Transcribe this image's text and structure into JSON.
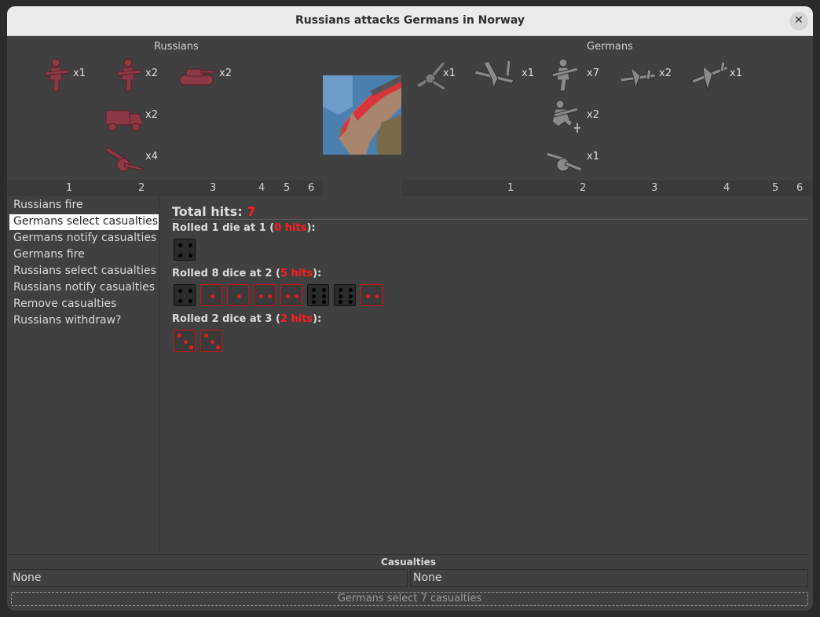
{
  "window": {
    "title": "Russians attacks Germans in Norway"
  },
  "attacker": {
    "name": "Russians",
    "units": [
      {
        "icon": "infantry-icon",
        "count": "x1"
      },
      {
        "icon": "infantry-icon",
        "count": "x2"
      },
      {
        "icon": "tank-icon",
        "count": "x2"
      },
      {
        "icon": "truck-icon",
        "count": "x2"
      },
      {
        "icon": "artillery-icon",
        "count": "x4"
      }
    ],
    "color": "#8b3a45"
  },
  "defender": {
    "name": "Germans",
    "units": [
      {
        "icon": "aa-gun-icon",
        "count": "x1"
      },
      {
        "icon": "bomber-icon",
        "count": "x1"
      },
      {
        "icon": "infantry-icon",
        "count": "x7"
      },
      {
        "icon": "fighter-icon",
        "count": "x2"
      },
      {
        "icon": "fighter-icon",
        "count": "x1"
      },
      {
        "icon": "marine-icon",
        "count": "x2"
      },
      {
        "icon": "artillery-icon",
        "count": "x1"
      }
    ],
    "color": "#7a7a7a"
  },
  "dice_labels": [
    "1",
    "2",
    "3",
    "4",
    "5",
    "6"
  ],
  "steps": [
    "Russians fire",
    "Germans select casualties",
    "Germans notify casualties",
    "Germans fire",
    "Russians select casualties",
    "Russians notify casualties",
    "Remove casualties",
    "Russians withdraw?"
  ],
  "selected_step": 1,
  "results": {
    "total_label": "Total hits:",
    "total_value": "7",
    "rolls": [
      {
        "prefix": "Rolled 1 die at 1 (",
        "hits": "0 hits",
        "suffix": "):",
        "dice": [
          {
            "face": 4,
            "hit": false
          }
        ]
      },
      {
        "prefix": "Rolled 8 dice at 2 (",
        "hits": "5 hits",
        "suffix": "):",
        "dice": [
          {
            "face": 4,
            "hit": false
          },
          {
            "face": 1,
            "hit": true
          },
          {
            "face": 1,
            "hit": true
          },
          {
            "face": 2,
            "hit": true
          },
          {
            "face": 2,
            "hit": true
          },
          {
            "face": 6,
            "hit": false
          },
          {
            "face": 6,
            "hit": false
          },
          {
            "face": 2,
            "hit": true
          }
        ]
      },
      {
        "prefix": "Rolled 2 dice at 3 (",
        "hits": "2 hits",
        "suffix": "):",
        "dice": [
          {
            "face": 3,
            "hit": true
          },
          {
            "face": 3,
            "hit": true
          }
        ]
      }
    ]
  },
  "casualties": {
    "title": "Casualties",
    "attacker": "None",
    "defender": "None"
  },
  "status_button": "Germans select 7 casualties",
  "colors": {
    "hit": "#ff1d1d",
    "background": "#404040"
  }
}
